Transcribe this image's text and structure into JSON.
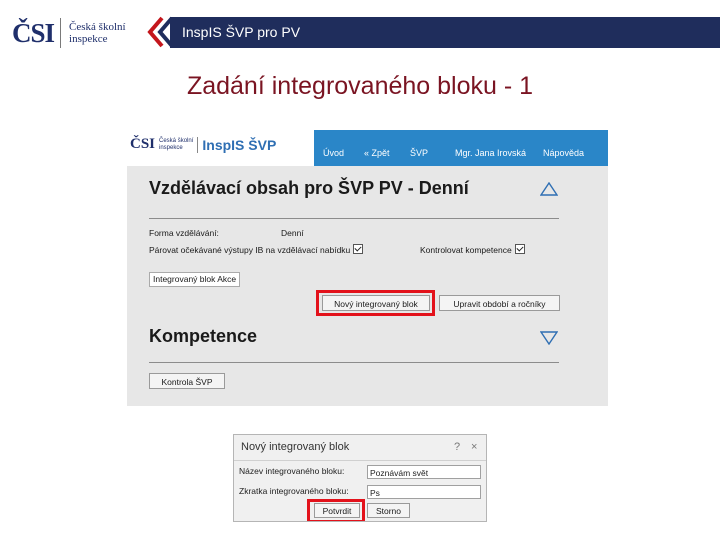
{
  "logo": {
    "mark": "ČSI",
    "line1": "Česká školní",
    "line2": "inspekce"
  },
  "header": {
    "title": "InspIS ŠVP pro PV"
  },
  "slide": {
    "title": "Zadání integrovaného bloku - 1"
  },
  "app": {
    "brand": {
      "mark": "ČSI",
      "line1": "Česká školní",
      "line2": "inspekce",
      "product": "InspIS ŠVP"
    },
    "nav": [
      "Úvod",
      "« Zpět",
      "ŠVP",
      "Mgr. Jana Irovská",
      "Nápověda"
    ],
    "section1": {
      "title": "Vzdělávací obsah pro ŠVP PV - Denní",
      "form_label": "Forma vzdělávání:",
      "form_value": "Denní",
      "check1_label": "Párovat očekávané výstupy IB na vzdělávací nabídku",
      "check2_label": "Kontrolovat kompetence",
      "tag": "Integrovaný blok Akce",
      "btn_new": "Nový integrovaný blok",
      "btn_edit": "Upravit období a ročníky"
    },
    "section2": {
      "title": "Kompetence",
      "btn_check": "Kontrola ŠVP"
    }
  },
  "dialog": {
    "title": "Nový integrovaný blok",
    "help": "?",
    "close": "×",
    "name_label": "Název integrovaného bloku:",
    "name_value": "Poznávám svět",
    "abbr_label": "Zkratka integrovaného bloku:",
    "abbr_value": "Ps",
    "confirm": "Potvrdit",
    "cancel": "Storno"
  },
  "colors": {
    "header_bar": "#1f2d5c",
    "title": "#7a1422",
    "nav": "#2a86c8",
    "highlight": "#e3121b",
    "chevron_red": "#c4161c"
  }
}
